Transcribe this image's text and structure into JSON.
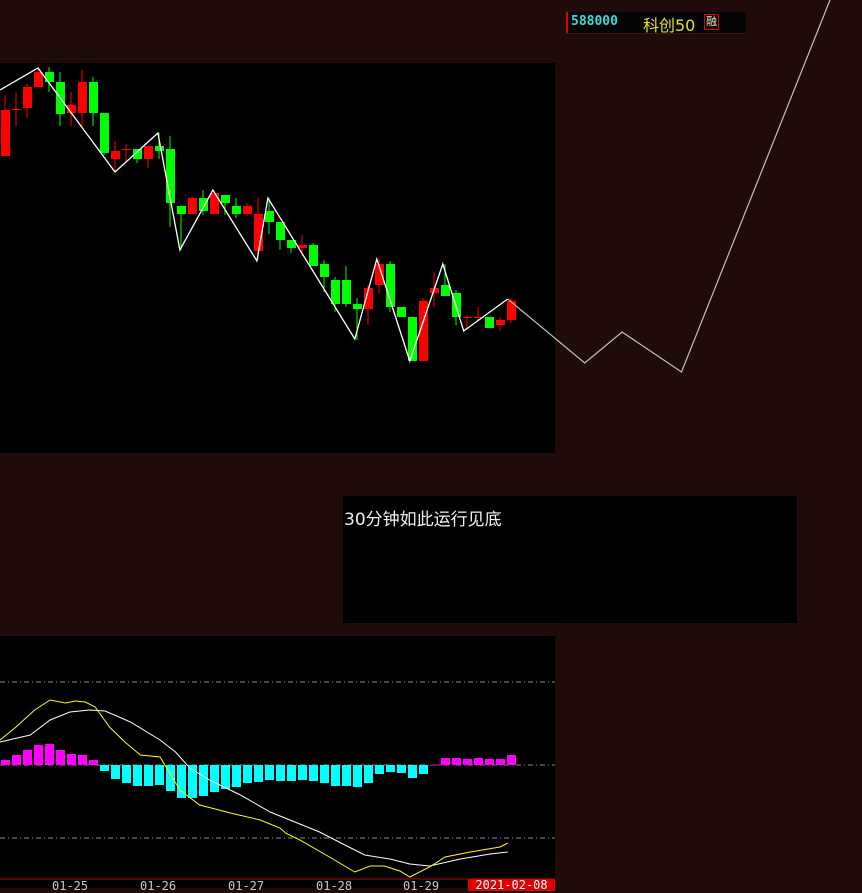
{
  "stock": {
    "code": "588000",
    "name": "科创50",
    "badge": "融"
  },
  "note": {
    "text": "30分钟如此运行见底"
  },
  "axis": {
    "dates": [
      "01-25",
      "01-26",
      "01-27",
      "01-28",
      "01-29"
    ],
    "current_date": "2021-02-08"
  },
  "colors": {
    "up": "#ff0000",
    "down": "#00ff00",
    "zigzag": "#ffffff",
    "projection": "#c0c0c0",
    "dif": "#ffff00",
    "dea": "#ffffff",
    "hist_pos": "#ff00ff",
    "hist_neg": "#00ffff"
  },
  "chart_data": {
    "type": "candlestick",
    "candles_ohlc": [
      [
        344,
        390,
        405,
        344
      ],
      [
        391,
        391,
        408,
        374
      ],
      [
        392,
        413,
        416,
        382
      ],
      [
        413,
        428,
        432,
        413
      ],
      [
        428,
        418,
        433,
        408
      ],
      [
        418,
        386,
        428,
        374
      ],
      [
        387,
        395,
        408,
        374
      ],
      [
        387,
        418,
        430,
        374
      ],
      [
        418,
        387,
        423,
        374
      ],
      [
        387,
        347,
        387,
        345
      ],
      [
        341,
        349,
        359,
        329
      ],
      [
        351,
        351,
        356,
        338
      ],
      [
        351,
        341,
        351,
        337
      ],
      [
        341,
        354,
        354,
        332
      ],
      [
        354,
        349,
        367,
        341
      ],
      [
        351,
        297,
        364,
        273
      ],
      [
        294,
        286,
        294,
        250
      ],
      [
        286,
        302,
        304,
        286
      ],
      [
        302,
        289,
        310,
        285
      ],
      [
        286,
        307,
        308,
        286
      ],
      [
        305,
        297,
        305,
        285
      ],
      [
        294,
        286,
        302,
        282
      ],
      [
        286,
        294,
        297,
        284
      ],
      [
        249,
        286,
        302,
        240
      ],
      [
        289,
        278,
        302,
        266
      ],
      [
        278,
        260,
        278,
        250
      ],
      [
        260,
        252,
        260,
        247
      ],
      [
        252,
        255,
        265,
        244
      ],
      [
        255,
        234,
        257,
        234
      ],
      [
        236,
        223,
        240,
        208
      ],
      [
        220,
        196,
        223,
        188
      ],
      [
        220,
        196,
        234,
        193
      ],
      [
        196,
        191,
        202,
        160
      ],
      [
        191,
        212,
        215,
        175
      ],
      [
        215,
        236,
        241,
        207
      ],
      [
        236,
        193,
        239,
        188
      ],
      [
        193,
        183,
        193,
        183
      ],
      [
        183,
        139,
        183,
        139
      ],
      [
        139,
        199,
        202,
        139
      ],
      [
        207,
        212,
        228,
        193
      ],
      [
        215,
        204,
        236,
        204
      ],
      [
        207,
        183,
        210,
        175
      ],
      [
        183,
        183,
        185,
        170
      ],
      [
        183,
        183,
        193,
        180
      ],
      [
        183,
        172,
        183,
        172
      ],
      [
        175,
        180,
        183,
        169
      ],
      [
        180,
        199,
        202,
        177
      ]
    ],
    "zigzag": [
      [
        -0.45,
        410
      ],
      [
        3,
        432
      ],
      [
        10,
        328
      ],
      [
        13.9,
        367
      ],
      [
        15.9,
        250
      ],
      [
        18.9,
        310
      ],
      [
        22.9,
        239
      ],
      [
        23.9,
        302
      ],
      [
        31.8,
        161
      ],
      [
        33.8,
        241
      ],
      [
        36.8,
        139
      ],
      [
        39.8,
        236
      ],
      [
        41.7,
        169
      ],
      [
        45.7,
        201
      ]
    ],
    "projection": [
      [
        45.7,
        201
      ],
      [
        52.7,
        137
      ],
      [
        56.1,
        168
      ],
      [
        61.5,
        128
      ],
      [
        75,
        500
      ]
    ],
    "macd": {
      "hist": [
        5,
        10,
        15,
        20,
        21,
        15,
        11,
        10,
        5,
        -6,
        -14,
        -18,
        -21,
        -21,
        -20,
        -26,
        -33,
        -33,
        -31,
        -27,
        -24,
        -22,
        -18,
        -17,
        -15,
        -16,
        -16,
        -15,
        -16,
        -18,
        -21,
        -21,
        -22,
        -18,
        -9,
        -7,
        -8,
        -13,
        -9,
        0.5,
        7,
        7,
        6,
        7,
        6,
        6,
        10
      ],
      "dif": [
        [
          -0.45,
          25
        ],
        [
          1,
          38
        ],
        [
          2.7,
          55
        ],
        [
          4.1,
          65
        ],
        [
          5.5,
          62
        ],
        [
          6.4,
          64
        ],
        [
          7.3,
          63
        ],
        [
          8.2,
          58
        ],
        [
          9.5,
          38
        ],
        [
          10.9,
          23
        ],
        [
          12.3,
          10
        ],
        [
          14.1,
          8
        ],
        [
          14.7,
          -3
        ],
        [
          15.9,
          -25
        ],
        [
          17.7,
          -40
        ],
        [
          20.5,
          -48
        ],
        [
          23.2,
          -55
        ],
        [
          25,
          -63
        ],
        [
          25.5,
          -68
        ],
        [
          26.8,
          -75
        ],
        [
          29.5,
          -92
        ],
        [
          31.8,
          -107
        ],
        [
          33.2,
          -101
        ],
        [
          34.5,
          -101
        ],
        [
          35.9,
          -106
        ],
        [
          36.8,
          -112
        ],
        [
          38.6,
          -102
        ],
        [
          40,
          -92
        ],
        [
          42.3,
          -87
        ],
        [
          45,
          -82
        ],
        [
          45.7,
          -78
        ]
      ],
      "dea": [
        [
          -0.45,
          23
        ],
        [
          2.3,
          30
        ],
        [
          4.1,
          45
        ],
        [
          5.9,
          53
        ],
        [
          7.7,
          55
        ],
        [
          9.1,
          54
        ],
        [
          11.4,
          43
        ],
        [
          14.1,
          25
        ],
        [
          15.5,
          13
        ],
        [
          16.8,
          -3
        ],
        [
          18.6,
          -15
        ],
        [
          21.4,
          -30
        ],
        [
          24.1,
          -47
        ],
        [
          25.9,
          -55
        ],
        [
          28.6,
          -67
        ],
        [
          30.9,
          -80
        ],
        [
          32.7,
          -90
        ],
        [
          35,
          -94
        ],
        [
          36.8,
          -99
        ],
        [
          38.6,
          -101
        ],
        [
          41.4,
          -94
        ],
        [
          44.1,
          -89
        ],
        [
          45.7,
          -87
        ]
      ],
      "levels": [
        83,
        0,
        -73
      ]
    }
  }
}
